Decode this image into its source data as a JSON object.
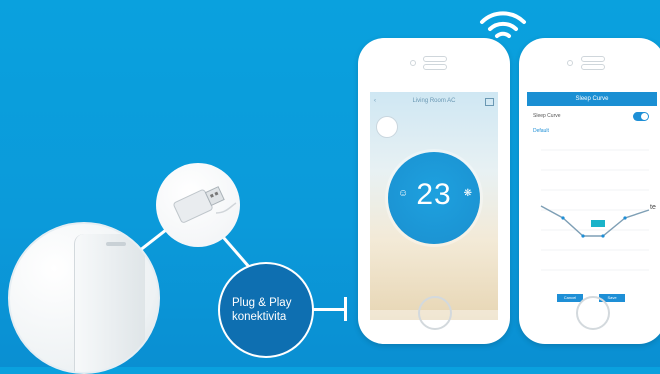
{
  "callout": {
    "line1": "Plug & Play",
    "line2": "konektivita"
  },
  "phone1": {
    "title": "Living Room AC",
    "temperature": "23"
  },
  "phone2": {
    "title": "Sleep Curve",
    "setting_label": "Sleep Curve",
    "option_label": "Default",
    "button_left": "Cancel",
    "button_right": "Save"
  },
  "side_text": "te",
  "colors": {
    "background": "#0aa1de",
    "accent": "#1e8fd6",
    "callout_bg": "#0e6fb1"
  },
  "icons": [
    "wifi-icon",
    "usb-dongle-icon",
    "air-conditioner-icon",
    "home-button-icon"
  ]
}
